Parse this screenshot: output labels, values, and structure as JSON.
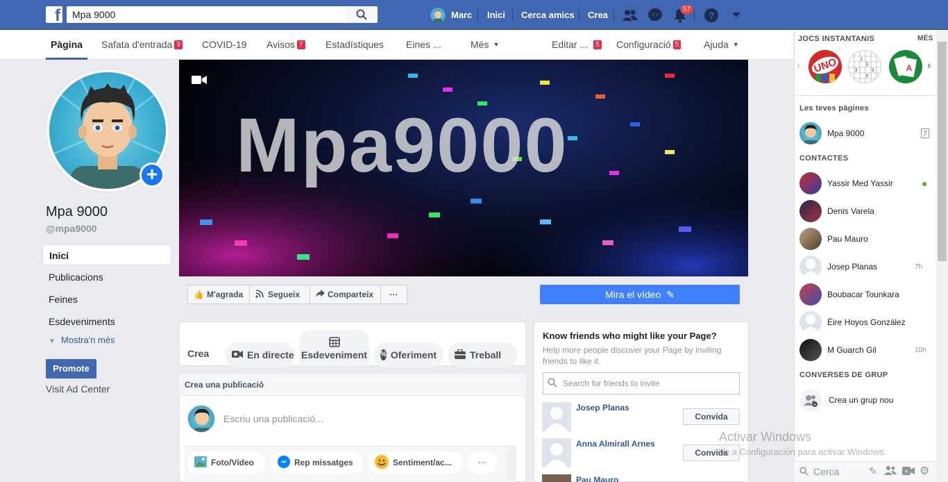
{
  "topbar": {
    "search_value": "Mpa 9000",
    "user_name": "Marc",
    "nav": [
      "Inici",
      "Cerca amics",
      "Crea"
    ],
    "notifications_count": "57"
  },
  "page_tabs": [
    {
      "label": "Pàgina"
    },
    {
      "label": "Safata d'entrada",
      "badge": "9"
    },
    {
      "label": "COVID-19"
    },
    {
      "label": "Avisos",
      "badge": "7"
    },
    {
      "label": "Estadístiques"
    },
    {
      "label": "Eines ..."
    },
    {
      "label": "Més"
    },
    {
      "label": "Editar ...",
      "badge": "5"
    },
    {
      "label": "Configuració",
      "badge": "5"
    },
    {
      "label": "Ajuda"
    }
  ],
  "profile": {
    "name": "Mpa 9000",
    "handle": "@mpa9000"
  },
  "left_nav": [
    "Inici",
    "Publicacions",
    "Feines",
    "Esdeveniments"
  ],
  "show_more": "Mostra'n més",
  "promote": "Promote",
  "ad_center": "Visit Ad Center",
  "cover": {
    "title": "Mpa9000"
  },
  "actions": {
    "like": "M'agrada",
    "follow": "Segueix",
    "share": "Comparteix",
    "more": "···",
    "watch_video": "Mira el vídeo"
  },
  "create": {
    "label": "Crea",
    "items": [
      "En directe",
      "Esdeveniment",
      "Oferiment",
      "Treball"
    ]
  },
  "post": {
    "header": "Crea una publicació",
    "placeholder": "Escriu una publicació...",
    "tools": [
      "Foto/Vídeo",
      "Rep missatges",
      "Sentiment/ac...",
      "···"
    ]
  },
  "invite": {
    "title": "Know friends who might like your Page?",
    "subtitle": "Help more people discover your Page by inviting friends to like it.",
    "search_placeholder": "Search for friends to invite",
    "button": "Convida",
    "friends": [
      "Josep Planas",
      "Anna Almirall Arnes",
      "Pau Mauro"
    ]
  },
  "sidebar": {
    "games_title": "JOCS INSTANTANIS",
    "games_more": "MÉS",
    "your_pages_title": "Les teves pàgines",
    "your_page": {
      "name": "Mpa 9000",
      "count": "7"
    },
    "contacts_title": "CONTACTES",
    "contacts": [
      {
        "name": "Yassir Med Yassir",
        "time": "",
        "online": true
      },
      {
        "name": "Denis Varela",
        "time": ""
      },
      {
        "name": "Pau Mauro",
        "time": ""
      },
      {
        "name": "Josep Planas",
        "time": "7h"
      },
      {
        "name": "Boubacar Tounkara",
        "time": ""
      },
      {
        "name": "Éire Hoyos González",
        "time": ""
      },
      {
        "name": "M Guarch Gil",
        "time": "10h"
      }
    ],
    "groups_title": "CONVERSES DE GRUP",
    "new_group": "Crea un grup nou",
    "search_placeholder": "Cerca"
  },
  "watermark": {
    "line1": "Activar Windows",
    "line2": "Ve a Configuración para activar Windows."
  }
}
